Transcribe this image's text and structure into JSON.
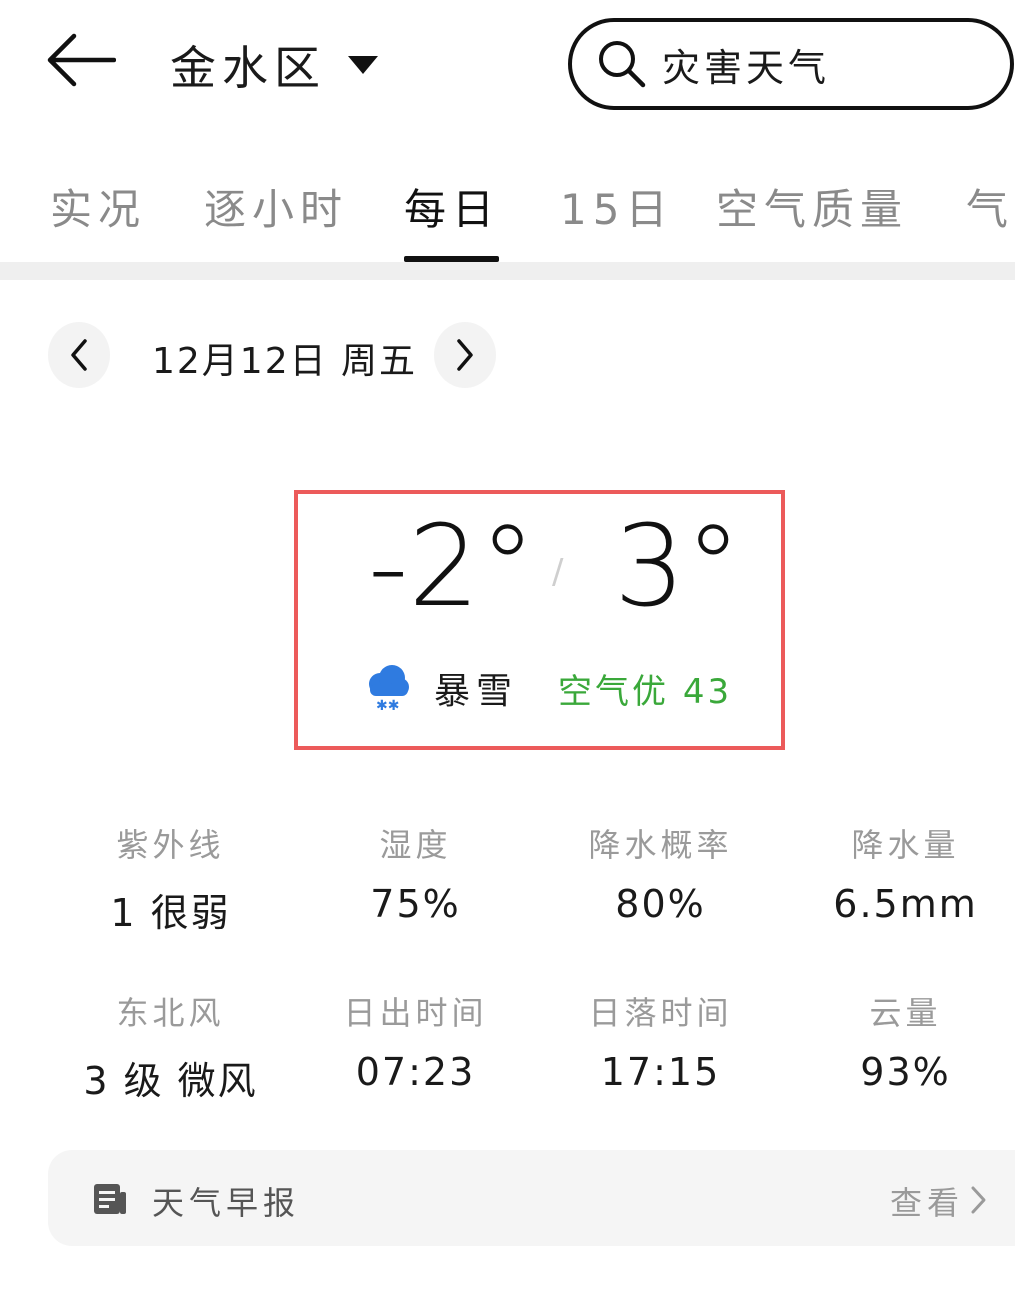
{
  "header": {
    "city": "金水区",
    "search_placeholder": "灾害天气"
  },
  "tabs": [
    {
      "label": "实况",
      "active": false
    },
    {
      "label": "逐小时",
      "active": false
    },
    {
      "label": "每日",
      "active": true
    },
    {
      "label": "15日",
      "active": false
    },
    {
      "label": "空气质量",
      "active": false
    },
    {
      "label": "气",
      "active": false
    }
  ],
  "date_nav": {
    "date": "12月12日 周五"
  },
  "forecast": {
    "low": "-2°",
    "high": "3°",
    "separator": "/",
    "condition": "暴雪",
    "condition_icon": "snow-cloud-icon",
    "air_quality": "空气优 43",
    "air_quality_color": "#3aa83a",
    "highlight_color": "#ec5a5a"
  },
  "details": [
    {
      "label": "紫外线",
      "value": "1 很弱"
    },
    {
      "label": "湿度",
      "value": "75%"
    },
    {
      "label": "降水概率",
      "value": "80%"
    },
    {
      "label": "降水量",
      "value": "6.5mm"
    },
    {
      "label": "东北风",
      "value": "3 级 微风"
    },
    {
      "label": "日出时间",
      "value": "07:23"
    },
    {
      "label": "日落时间",
      "value": "17:15"
    },
    {
      "label": "云量",
      "value": "93%"
    }
  ],
  "report": {
    "title": "天气早报",
    "action": "查看"
  }
}
